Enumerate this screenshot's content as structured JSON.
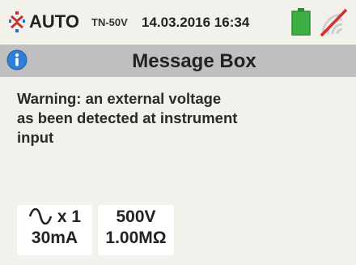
{
  "status": {
    "mode": "AUTO",
    "system": "TN-50V",
    "datetime": "14.03.2016  16:34",
    "battery_color": "#3cb043",
    "mode_icon": "auto-mode-icon",
    "battery_icon": "battery-icon",
    "signal_icon": "wireless-off-icon"
  },
  "title_bar": {
    "icon": "info-icon",
    "title": "Message Box",
    "background": "#bfbfbf"
  },
  "message": {
    "text": "Warning: an external voltage\nas been detected at instrument\ninput"
  },
  "params": [
    {
      "icon": "ac-wave-icon",
      "line1": "x 1",
      "line2": "30mA"
    },
    {
      "line1": "500V",
      "line2": "1.00MΩ"
    }
  ]
}
